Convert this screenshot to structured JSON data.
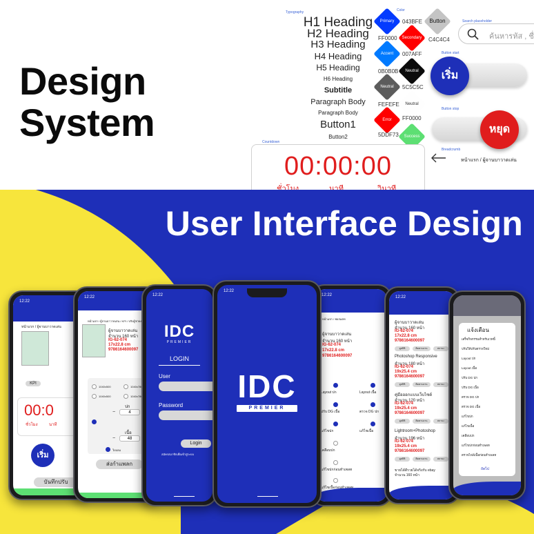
{
  "hero": {
    "line1": "Design",
    "line2": "System",
    "banner": "User Interface Design"
  },
  "typography": {
    "label": "Typography",
    "items": [
      "H1 Heading",
      "H2 Heading",
      "H3 Heading",
      "H4 Heading",
      "H5 Heading",
      "H6 Heading",
      "Subtitle",
      "Paragraph Body",
      "Paragraph Body",
      "Button1",
      "Button2"
    ]
  },
  "colors": {
    "label": "Color",
    "swatches": [
      {
        "name": "Primary",
        "hex": "043BFE",
        "color": "#043bfe"
      },
      {
        "name": "Secondary",
        "hex": "FF0000",
        "color": "#ff0000"
      },
      {
        "name": "Accent",
        "hex": "007AFF",
        "color": "#007aff"
      },
      {
        "name": "Neutral",
        "hex": "0B0B0B",
        "color": "#0b0b0b"
      },
      {
        "name": "Neutral",
        "hex": "5C5C5C",
        "color": "#5c5c5c"
      },
      {
        "name": "Neutral",
        "hex": "FEFEFE",
        "color": "#fefefe"
      },
      {
        "name": "Error",
        "hex": "FF0000",
        "color": "#ff0000"
      },
      {
        "name": "Success",
        "hex": "5DDF73",
        "color": "#5ddf73"
      }
    ],
    "button_swatch": {
      "label": "Button",
      "hex": "C4C4C4",
      "color": "#c4c4c4"
    }
  },
  "search": {
    "label": "Search placeholder",
    "placeholder": "ค้นหารหัส , ชื่"
  },
  "button_start": {
    "label": "Button start",
    "text": "เริ่ม"
  },
  "button_stop": {
    "label": "Button stop",
    "text": "หยุด"
  },
  "breadcrumb": {
    "label": "Breadcrumb",
    "text": "หน้าแรก / ผู้จานบาวาดเล่น"
  },
  "countdown": {
    "label": "Countdown",
    "time": "00:00:00",
    "units": [
      "ชั่วโมง",
      "นาที",
      "วินาที"
    ]
  },
  "phones": {
    "time": "12:22",
    "p1": {
      "back": "หน้าแรก / ผู้จานบาวาดเล่น",
      "timer": "00:0",
      "units": [
        "ชั่วโมง",
        "นาที"
      ],
      "start": "เริ่ม",
      "save": "บันทึกปรับ",
      "chip": "KPI"
    },
    "p2": {
      "back": "หน้าแรก / ผู้จานบาวาดเล่น / KPI / ปรับผู้ช่วยงาน",
      "title": "ผู้จานบาวาดเล่น",
      "pages": "จำนวน 160 หน้า",
      "code": "IG-62-074",
      "size": "17x22.8 cm",
      "isbn": "9786164600097",
      "opts": [
        "1040x500",
        "1040x780"
      ],
      "labels": [
        "ปก",
        "เนื้อ"
      ],
      "qty1": "4",
      "qty2": "48",
      "send": "ส่งกำแพลก",
      "tag": "ใบบลม"
    },
    "p3": {
      "logo": "IDC",
      "sub": "PREMIER",
      "login_title": "LOGIN",
      "user": "User",
      "password": "Password",
      "login": "Login",
      "register": "สมัครสมาชิกเพื่อเข้าสู่ระบบ"
    },
    "p4": {
      "logo": "IDC",
      "sub": "PREMIER"
    },
    "p5": {
      "crumb": "หน้าแรก / ฟอสแตท",
      "title": "ผู้จานบาวาดเล่น",
      "pages": "จำนวน 160 หน้า",
      "code": "IG-62-074",
      "size": "17x22.8 cm",
      "isbn": "9786164600097",
      "opts": [
        "Layout ปก",
        "Layout เนื้อ",
        "ปรับ DG เนื้อ",
        "ตรวจ DG ปก",
        "แก้ไขปก",
        "แก้ไขเนื้อ",
        "เคลือบปก",
        "แก้ไขปกก่อนทำเพลท",
        "แก้ไขเนื้อก่อนทำเพลท"
      ]
    },
    "p6": {
      "items": [
        {
          "title": "ผู้จานบาวาดเล่น",
          "pages": "จำนวน 160 หน้า",
          "code": "IG-62-074",
          "size": "17x22.8 cm",
          "isbn": "9786164600097"
        },
        {
          "title": "Photoshop Responsive",
          "pages": "จำนวน 180 หน้า",
          "code": "IG-62-074",
          "size": "19x25.4 cm",
          "isbn": "9786164600097"
        },
        {
          "title": "คู่มือออกแบบเว็บไซต์",
          "pages": "จำนวน 120 หน้า",
          "code": "IG-62-074",
          "size": "19x25.4 cm",
          "isbn": "9786164600097"
        },
        {
          "title": "Lightroom+Photoshop",
          "pages": "จำนวน 196 หน้า",
          "code": "IG-62-074",
          "size": "19x25.4 cm",
          "isbn": "9786164600097"
        },
        {
          "title": "ขายได้ดีรวยได้จริงกับ ebay",
          "pages": "จำนวน 160 หน้า",
          "code": "",
          "size": "",
          "isbn": ""
        }
      ],
      "buttons": [
        "ดูสถิติ",
        "ติดตามงาน",
        "สถานะ"
      ]
    },
    "p7": {
      "title": "แจ้งเตือน",
      "items": [
        "เสร็จกิจกรรมสำหรับเวทนี้",
        "ปรับให้ปรับตรวจใหม่",
        "Layout ปก",
        "Layout เนื้อ",
        "ปรับ DG ปก",
        "ปรับ DG เนื้อ",
        "ตรวจ DG ปก",
        "ตรวจ DG เนื้อ",
        "แก้ไขปก",
        "แก้ไขเนื้อ",
        "เคลือบปก",
        "แก้ไขปกก่อนทำเพลท",
        "ตรวจไฟล์เนื้อก่อนทำเพลท"
      ],
      "next": "ถัดไป"
    }
  },
  "theme": {
    "blue": "#1e2fb8",
    "yellow": "#f7e53c",
    "red": "#e01d1d"
  }
}
